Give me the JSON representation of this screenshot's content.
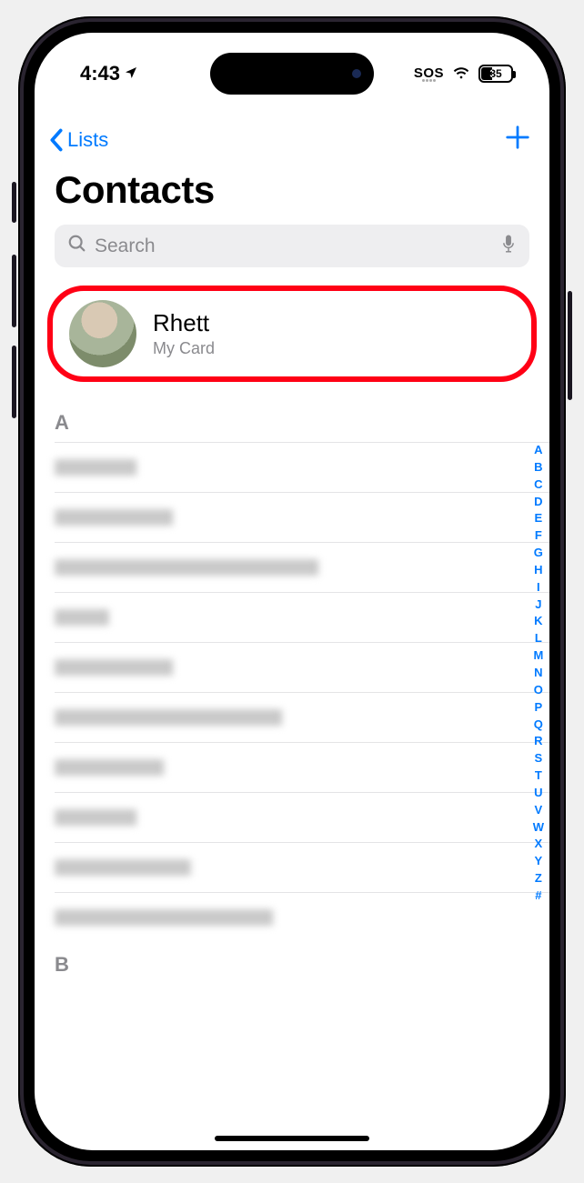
{
  "status": {
    "time": "4:43",
    "sos": "SOS",
    "battery_percent": "35"
  },
  "nav": {
    "back_label": "Lists"
  },
  "page": {
    "title": "Contacts"
  },
  "search": {
    "placeholder": "Search"
  },
  "my_card": {
    "name": "Rhett",
    "subtitle": "My Card"
  },
  "sections": {
    "A": "A",
    "B": "B"
  },
  "index_letters": [
    "A",
    "B",
    "C",
    "D",
    "E",
    "F",
    "G",
    "H",
    "I",
    "J",
    "K",
    "L",
    "M",
    "N",
    "O",
    "P",
    "Q",
    "R",
    "S",
    "T",
    "U",
    "V",
    "W",
    "X",
    "Y",
    "Z",
    "#"
  ],
  "blur_widths_a": [
    90,
    130,
    290,
    60,
    130,
    250,
    120,
    90,
    150,
    240
  ]
}
